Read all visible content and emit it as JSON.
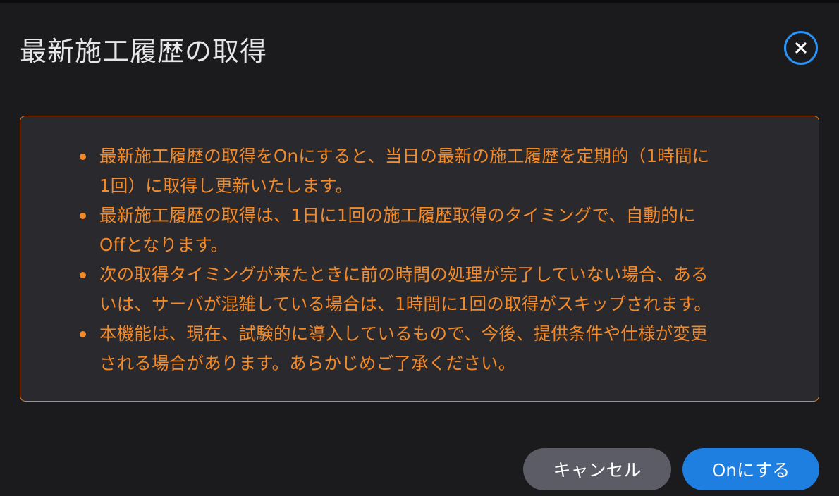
{
  "dialog": {
    "title": "最新施工履歴の取得",
    "close_icon": "close-icon",
    "accent_color": "#2a93f5",
    "notice_color": "#f28a2a"
  },
  "notice": {
    "items": [
      {
        "line1": "最新施工履歴の取得をOnにすると、当日の最新の施工履歴を定期的（1時間に",
        "line2": "1回）に取得し更新いたします。"
      },
      {
        "line1": "最新施工履歴の取得は、1日に1回の施工履歴取得のタイミングで、自動的に",
        "line2": "Offとなります。"
      },
      {
        "line1": "次の取得タイミングが来たときに前の時間の処理が完了していない場合、ある",
        "line2": "いは、サーバが混雑している場合は、1時間に1回の取得がスキップされます。"
      },
      {
        "line1": "本機能は、現在、試験的に導入しているもので、今後、提供条件や仕様が変更",
        "line2": "される場合があります。あらかじめご了承ください。"
      }
    ]
  },
  "buttons": {
    "cancel_label": "キャンセル",
    "on_label": "Onにする"
  }
}
